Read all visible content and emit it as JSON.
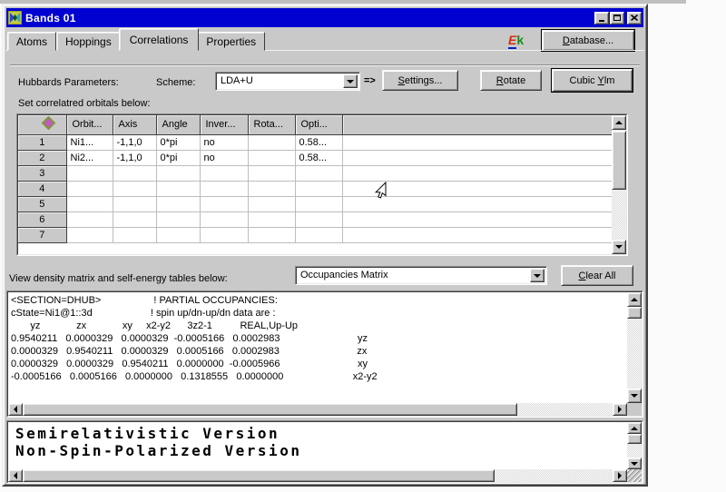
{
  "window": {
    "title": "Bands 01"
  },
  "tabs": [
    {
      "label": "Atoms"
    },
    {
      "label": "Hoppings"
    },
    {
      "label": "Correlations",
      "active": true
    },
    {
      "label": "Properties"
    }
  ],
  "header": {
    "ek_logo": {
      "e": "E",
      "k": "k"
    },
    "database_button": {
      "u": "D",
      "rest": "atabase..."
    }
  },
  "params": {
    "label": "Hubbards Parameters:",
    "scheme_label": "Scheme:",
    "scheme_value": "LDA+U",
    "arrow": "=>",
    "settings_button": {
      "u": "S",
      "rest": "ettings..."
    },
    "rotate_button": {
      "u": "R",
      "rest": "otate"
    },
    "cubic_button": {
      "pre": "Cubic ",
      "u": "Y",
      "rest": "lm"
    }
  },
  "orbitals": {
    "caption": "Set correlatred orbitals below:",
    "columns": [
      "Orbit...",
      "Axis",
      "Angle",
      "Inver...",
      "Rota...",
      "Opti..."
    ],
    "rows": [
      {
        "num": "1",
        "cells": [
          "Ni1...",
          "-1,1,0",
          "0*pi",
          "no",
          "",
          "0.58..."
        ]
      },
      {
        "num": "2",
        "cells": [
          "Ni2...",
          "-1,1,0",
          "0*pi",
          "no",
          "",
          "0.58..."
        ]
      },
      {
        "num": "3",
        "cells": [
          "",
          "",
          "",
          "",
          "",
          ""
        ]
      },
      {
        "num": "4",
        "cells": [
          "",
          "",
          "",
          "",
          "",
          ""
        ]
      },
      {
        "num": "5",
        "cells": [
          "",
          "",
          "",
          "",
          "",
          ""
        ]
      },
      {
        "num": "6",
        "cells": [
          "",
          "",
          "",
          "",
          "",
          ""
        ]
      },
      {
        "num": "7",
        "cells": [
          "",
          "",
          "",
          "",
          "",
          ""
        ]
      }
    ]
  },
  "density": {
    "label": "View density matrix and self-energy tables below:",
    "dropdown_value": "Occupancies Matrix",
    "clear_button": {
      "u": "C",
      "rest": "lear All"
    }
  },
  "occupancies": {
    "lines": [
      "<SECTION=DHUB>                   ! PARTIAL OCCUPANCIES:",
      "cState=Ni1@1::3d                     ! spin up/dn-up/dn data are :",
      "       yz             zx             xy     x2-y2      3z2-1          REAL,Up-Up",
      "0.9540211   0.0000329   0.0000329  -0.0005166   0.0002983                            yz",
      "0.0000329   0.9540211   0.0000329   0.0005166   0.0002983                            zx",
      "0.0000329   0.0000329   0.9540211   0.0000000  -0.0005966                            xy",
      "-0.0005166   0.0005166   0.0000000   0.1318555   0.0000000                         x2-y2"
    ]
  },
  "versions": {
    "lines": [
      "Semirelativistic Version",
      "Non-Spin-Polarized Version"
    ]
  },
  "theme": {
    "face": "#c9c9c9",
    "titlebar": "#0000d0",
    "ek_red": "#d43010",
    "ek_green": "#1a8c1a",
    "diamond_fill": "#c357c3",
    "diamond_edge": "#7d9b33"
  }
}
